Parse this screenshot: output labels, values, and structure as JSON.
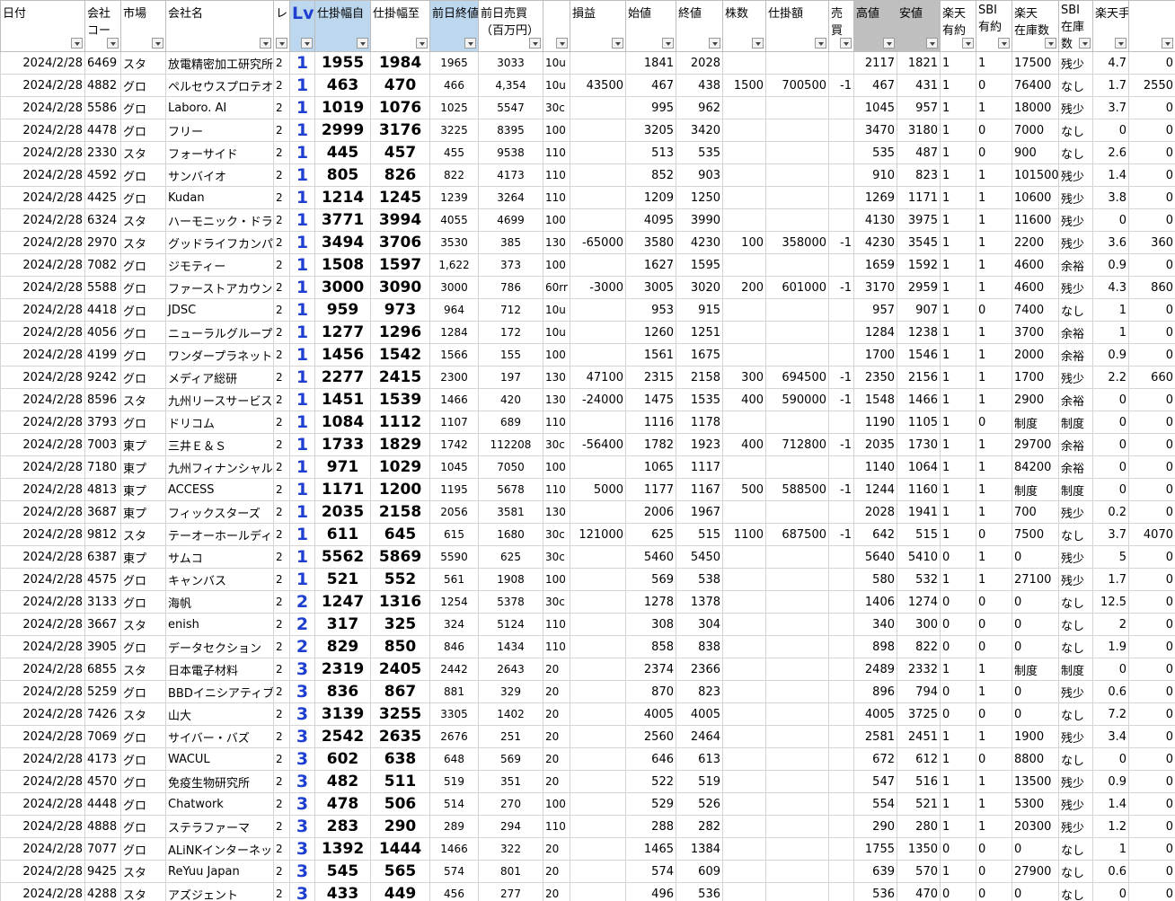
{
  "headers": [
    {
      "label": "日付",
      "label2": ""
    },
    {
      "label": "会社",
      "label2": "コー"
    },
    {
      "label": "市場",
      "label2": ""
    },
    {
      "label": "会社名",
      "label2": ""
    },
    {
      "label": "レ",
      "label2": ""
    },
    {
      "label": "Lv",
      "label2": ""
    },
    {
      "label": "仕掛幅自",
      "label2": ""
    },
    {
      "label": "仕掛幅至",
      "label2": ""
    },
    {
      "label": "前日終値",
      "label2": ""
    },
    {
      "label": "前日売買",
      "label2": "（百万円）"
    },
    {
      "label": "",
      "label2": ""
    },
    {
      "label": "損益",
      "label2": ""
    },
    {
      "label": "始値",
      "label2": ""
    },
    {
      "label": "終値",
      "label2": ""
    },
    {
      "label": "株数",
      "label2": ""
    },
    {
      "label": "仕掛額",
      "label2": ""
    },
    {
      "label": "売",
      "label2": "買"
    },
    {
      "label": "高値",
      "label2": ""
    },
    {
      "label": "安値",
      "label2": ""
    },
    {
      "label": "楽天",
      "label2": "有約"
    },
    {
      "label": "SBI",
      "label2": "有約"
    },
    {
      "label": "楽天",
      "label2": "在庫数"
    },
    {
      "label": "SBI",
      "label2": "在庫",
      "label3": "数"
    },
    {
      "label": "楽天手数料",
      "label2": ""
    },
    {
      "label": "",
      "label2": ""
    }
  ],
  "rows": [
    [
      "2024/2/28",
      "6469",
      "スタ",
      "放電精密加工研究所",
      "2",
      "1",
      "1955",
      "1984",
      "1965",
      "3033",
      "10u",
      "",
      "1841",
      "2028",
      "",
      "",
      "",
      "2117",
      "1821",
      "1",
      "1",
      "17500",
      "残少",
      "4.7",
      "0"
    ],
    [
      "2024/2/28",
      "4882",
      "グロ",
      "ペルセウスプロテオミクス",
      "2",
      "1",
      "463",
      "470",
      "466",
      "4,354",
      "10u",
      "43500",
      "467",
      "438",
      "1500",
      "700500",
      "-1",
      "467",
      "431",
      "1",
      "0",
      "76400",
      "なし",
      "1.7",
      "2550"
    ],
    [
      "2024/2/28",
      "5586",
      "グロ",
      "Laboro. AI",
      "2",
      "1",
      "1019",
      "1076",
      "1025",
      "5547",
      "30c",
      "",
      "995",
      "962",
      "",
      "",
      "",
      "1045",
      "957",
      "1",
      "1",
      "18000",
      "残少",
      "3.7",
      "0"
    ],
    [
      "2024/2/28",
      "4478",
      "グロ",
      "フリー",
      "2",
      "1",
      "2999",
      "3176",
      "3225",
      "8395",
      "100",
      "",
      "3205",
      "3420",
      "",
      "",
      "",
      "3470",
      "3180",
      "1",
      "0",
      "7000",
      "なし",
      "0",
      "0"
    ],
    [
      "2024/2/28",
      "2330",
      "スタ",
      "フォーサイド",
      "2",
      "1",
      "445",
      "457",
      "455",
      "9538",
      "110",
      "",
      "513",
      "535",
      "",
      "",
      "",
      "535",
      "487",
      "1",
      "0",
      "900",
      "なし",
      "2.6",
      "0"
    ],
    [
      "2024/2/28",
      "4592",
      "グロ",
      "サンバイオ",
      "2",
      "1",
      "805",
      "826",
      "822",
      "4173",
      "110",
      "",
      "852",
      "903",
      "",
      "",
      "",
      "910",
      "823",
      "1",
      "1",
      "101500",
      "残少",
      "1.4",
      "0"
    ],
    [
      "2024/2/28",
      "4425",
      "グロ",
      "Kudan",
      "2",
      "1",
      "1214",
      "1245",
      "1239",
      "3264",
      "110",
      "",
      "1209",
      "1250",
      "",
      "",
      "",
      "1269",
      "1171",
      "1",
      "1",
      "10600",
      "残少",
      "3.8",
      "0"
    ],
    [
      "2024/2/28",
      "6324",
      "スタ",
      "ハーモニック・ドライブ",
      "2",
      "1",
      "3771",
      "3994",
      "4055",
      "4699",
      "100",
      "",
      "4095",
      "3990",
      "",
      "",
      "",
      "4130",
      "3975",
      "1",
      "1",
      "11600",
      "残少",
      "0",
      "0"
    ],
    [
      "2024/2/28",
      "2970",
      "スタ",
      "グッドライフカンパニー",
      "2",
      "1",
      "3494",
      "3706",
      "3530",
      "385",
      "130",
      "-65000",
      "3580",
      "4230",
      "100",
      "358000",
      "-1",
      "4230",
      "3545",
      "1",
      "1",
      "2200",
      "残少",
      "3.6",
      "360"
    ],
    [
      "2024/2/28",
      "7082",
      "グロ",
      "ジモティー",
      "2",
      "1",
      "1508",
      "1597",
      "1,622",
      "373",
      "100",
      "",
      "1627",
      "1595",
      "",
      "",
      "",
      "1659",
      "1592",
      "1",
      "1",
      "4600",
      "余裕",
      "0.9",
      "0"
    ],
    [
      "2024/2/28",
      "5588",
      "グロ",
      "ファーストアカウンティング",
      "2",
      "1",
      "3000",
      "3090",
      "3000",
      "786",
      "60rr",
      "-3000",
      "3005",
      "3020",
      "200",
      "601000",
      "-1",
      "3170",
      "2959",
      "1",
      "1",
      "4600",
      "残少",
      "4.3",
      "860"
    ],
    [
      "2024/2/28",
      "4418",
      "グロ",
      "JDSC",
      "2",
      "1",
      "959",
      "973",
      "964",
      "712",
      "10u",
      "",
      "953",
      "915",
      "",
      "",
      "",
      "957",
      "907",
      "1",
      "0",
      "7400",
      "なし",
      "1",
      "0"
    ],
    [
      "2024/2/28",
      "4056",
      "グロ",
      "ニューラルグループ",
      "2",
      "1",
      "1277",
      "1296",
      "1284",
      "172",
      "10u",
      "",
      "1260",
      "1251",
      "",
      "",
      "",
      "1284",
      "1238",
      "1",
      "1",
      "3700",
      "余裕",
      "1",
      "0"
    ],
    [
      "2024/2/28",
      "4199",
      "グロ",
      "ワンダープラネット",
      "2",
      "1",
      "1456",
      "1542",
      "1566",
      "155",
      "100",
      "",
      "1561",
      "1675",
      "",
      "",
      "",
      "1700",
      "1546",
      "1",
      "1",
      "2000",
      "余裕",
      "0.9",
      "0"
    ],
    [
      "2024/2/28",
      "9242",
      "グロ",
      "メディア総研",
      "2",
      "1",
      "2277",
      "2415",
      "2300",
      "197",
      "130",
      "47100",
      "2315",
      "2158",
      "300",
      "694500",
      "-1",
      "2350",
      "2156",
      "1",
      "1",
      "1700",
      "残少",
      "2.2",
      "660"
    ],
    [
      "2024/2/28",
      "8596",
      "スタ",
      "九州リースサービス",
      "2",
      "1",
      "1451",
      "1539",
      "1466",
      "420",
      "130",
      "-24000",
      "1475",
      "1535",
      "400",
      "590000",
      "-1",
      "1548",
      "1466",
      "1",
      "1",
      "2900",
      "余裕",
      "0",
      "0"
    ],
    [
      "2024/2/28",
      "3793",
      "グロ",
      "ドリコム",
      "2",
      "1",
      "1084",
      "1112",
      "1107",
      "689",
      "110",
      "",
      "1116",
      "1178",
      "",
      "",
      "",
      "1190",
      "1105",
      "1",
      "0",
      "制度",
      "制度",
      "0",
      "0"
    ],
    [
      "2024/2/28",
      "7003",
      "東プ",
      "三井Ｅ＆Ｓ",
      "2",
      "1",
      "1733",
      "1829",
      "1742",
      "112208",
      "30c",
      "-56400",
      "1782",
      "1923",
      "400",
      "712800",
      "-1",
      "2035",
      "1730",
      "1",
      "1",
      "29700",
      "余裕",
      "0",
      "0"
    ],
    [
      "2024/2/28",
      "7180",
      "東プ",
      "九州フィナンシャルグループ",
      "2",
      "1",
      "971",
      "1029",
      "1045",
      "7050",
      "100",
      "",
      "1065",
      "1117",
      "",
      "",
      "",
      "1140",
      "1064",
      "1",
      "1",
      "84200",
      "余裕",
      "0",
      "0"
    ],
    [
      "2024/2/28",
      "4813",
      "東プ",
      "ACCESS",
      "2",
      "1",
      "1171",
      "1200",
      "1195",
      "5678",
      "110",
      "5000",
      "1177",
      "1167",
      "500",
      "588500",
      "-1",
      "1244",
      "1160",
      "1",
      "1",
      "制度",
      "制度",
      "0",
      "0"
    ],
    [
      "2024/2/28",
      "3687",
      "東プ",
      "フィックスターズ",
      "2",
      "1",
      "2035",
      "2158",
      "2056",
      "3581",
      "130",
      "",
      "2006",
      "1967",
      "",
      "",
      "",
      "2028",
      "1941",
      "1",
      "1",
      "700",
      "残少",
      "0.2",
      "0"
    ],
    [
      "2024/2/28",
      "9812",
      "スタ",
      "テーオーホールディングス",
      "2",
      "1",
      "611",
      "645",
      "615",
      "1680",
      "30c",
      "121000",
      "625",
      "515",
      "1100",
      "687500",
      "-1",
      "642",
      "515",
      "1",
      "0",
      "7500",
      "なし",
      "3.7",
      "4070"
    ],
    [
      "2024/2/28",
      "6387",
      "東プ",
      "サムコ",
      "2",
      "1",
      "5562",
      "5869",
      "5590",
      "625",
      "30c",
      "",
      "5460",
      "5450",
      "",
      "",
      "",
      "5640",
      "5410",
      "0",
      "1",
      "0",
      "残少",
      "5",
      "0"
    ],
    [
      "2024/2/28",
      "4575",
      "グロ",
      "キャンバス",
      "2",
      "1",
      "521",
      "552",
      "561",
      "1908",
      "100",
      "",
      "569",
      "538",
      "",
      "",
      "",
      "580",
      "532",
      "1",
      "1",
      "27100",
      "残少",
      "1.7",
      "0"
    ],
    [
      "2024/2/28",
      "3133",
      "グロ",
      "海帆",
      "2",
      "2",
      "1247",
      "1316",
      "1254",
      "5378",
      "30c",
      "",
      "1278",
      "1378",
      "",
      "",
      "",
      "1406",
      "1274",
      "0",
      "0",
      "0",
      "なし",
      "12.5",
      "0"
    ],
    [
      "2024/2/28",
      "3667",
      "スタ",
      "enish",
      "2",
      "2",
      "317",
      "325",
      "324",
      "5124",
      "110",
      "",
      "308",
      "304",
      "",
      "",
      "",
      "340",
      "300",
      "0",
      "0",
      "0",
      "なし",
      "2",
      "0"
    ],
    [
      "2024/2/28",
      "3905",
      "グロ",
      "データセクション",
      "2",
      "2",
      "829",
      "850",
      "846",
      "1434",
      "110",
      "",
      "858",
      "838",
      "",
      "",
      "",
      "898",
      "822",
      "0",
      "0",
      "0",
      "なし",
      "1.9",
      "0"
    ],
    [
      "2024/2/28",
      "6855",
      "スタ",
      "日本電子材料",
      "2",
      "3",
      "2319",
      "2405",
      "2442",
      "2643",
      "20",
      "",
      "2374",
      "2366",
      "",
      "",
      "",
      "2489",
      "2332",
      "1",
      "1",
      "制度",
      "制度",
      "0",
      "0"
    ],
    [
      "2024/2/28",
      "5259",
      "グロ",
      "BBDイニシアティブ",
      "2",
      "3",
      "836",
      "867",
      "881",
      "329",
      "20",
      "",
      "870",
      "823",
      "",
      "",
      "",
      "896",
      "794",
      "0",
      "1",
      "0",
      "残少",
      "0.6",
      "0"
    ],
    [
      "2024/2/28",
      "7426",
      "スタ",
      "山大",
      "2",
      "3",
      "3139",
      "3255",
      "3305",
      "1402",
      "20",
      "",
      "4005",
      "4005",
      "",
      "",
      "",
      "4005",
      "3725",
      "0",
      "0",
      "0",
      "なし",
      "7.2",
      "0"
    ],
    [
      "2024/2/28",
      "7069",
      "グロ",
      "サイバー・バズ",
      "2",
      "3",
      "2542",
      "2635",
      "2676",
      "251",
      "20",
      "",
      "2560",
      "2464",
      "",
      "",
      "",
      "2581",
      "2451",
      "1",
      "1",
      "1900",
      "残少",
      "3.4",
      "0"
    ],
    [
      "2024/2/28",
      "4173",
      "グロ",
      "WACUL",
      "2",
      "3",
      "602",
      "638",
      "648",
      "569",
      "20",
      "",
      "646",
      "613",
      "",
      "",
      "",
      "672",
      "612",
      "1",
      "0",
      "8800",
      "なし",
      "0",
      "0"
    ],
    [
      "2024/2/28",
      "4570",
      "グロ",
      "免疫生物研究所",
      "2",
      "3",
      "482",
      "511",
      "519",
      "351",
      "20",
      "",
      "522",
      "519",
      "",
      "",
      "",
      "547",
      "516",
      "1",
      "1",
      "13500",
      "残少",
      "0.9",
      "0"
    ],
    [
      "2024/2/28",
      "4448",
      "グロ",
      "Chatwork",
      "2",
      "3",
      "478",
      "506",
      "514",
      "270",
      "100",
      "",
      "529",
      "526",
      "",
      "",
      "",
      "554",
      "521",
      "1",
      "1",
      "5300",
      "残少",
      "1.4",
      "0"
    ],
    [
      "2024/2/28",
      "4888",
      "グロ",
      "ステラファーマ",
      "2",
      "3",
      "283",
      "290",
      "289",
      "294",
      "110",
      "",
      "288",
      "282",
      "",
      "",
      "",
      "290",
      "280",
      "1",
      "1",
      "20300",
      "残少",
      "1.2",
      "0"
    ],
    [
      "2024/2/28",
      "7077",
      "グロ",
      "ALiNKインターネット",
      "2",
      "3",
      "1392",
      "1444",
      "1466",
      "322",
      "20",
      "",
      "1465",
      "1384",
      "",
      "",
      "",
      "1755",
      "1350",
      "0",
      "0",
      "0",
      "なし",
      "1",
      "0"
    ],
    [
      "2024/2/28",
      "9425",
      "スタ",
      "ReYuu Japan",
      "2",
      "3",
      "545",
      "565",
      "574",
      "801",
      "20",
      "",
      "574",
      "609",
      "",
      "",
      "",
      "639",
      "570",
      "1",
      "0",
      "27900",
      "なし",
      "0.6",
      "0"
    ],
    [
      "2024/2/28",
      "4288",
      "スタ",
      "アズジェント",
      "2",
      "3",
      "433",
      "449",
      "456",
      "277",
      "20",
      "",
      "496",
      "536",
      "",
      "",
      "",
      "536",
      "470",
      "0",
      "0",
      "0",
      "なし",
      "0",
      "0"
    ]
  ]
}
